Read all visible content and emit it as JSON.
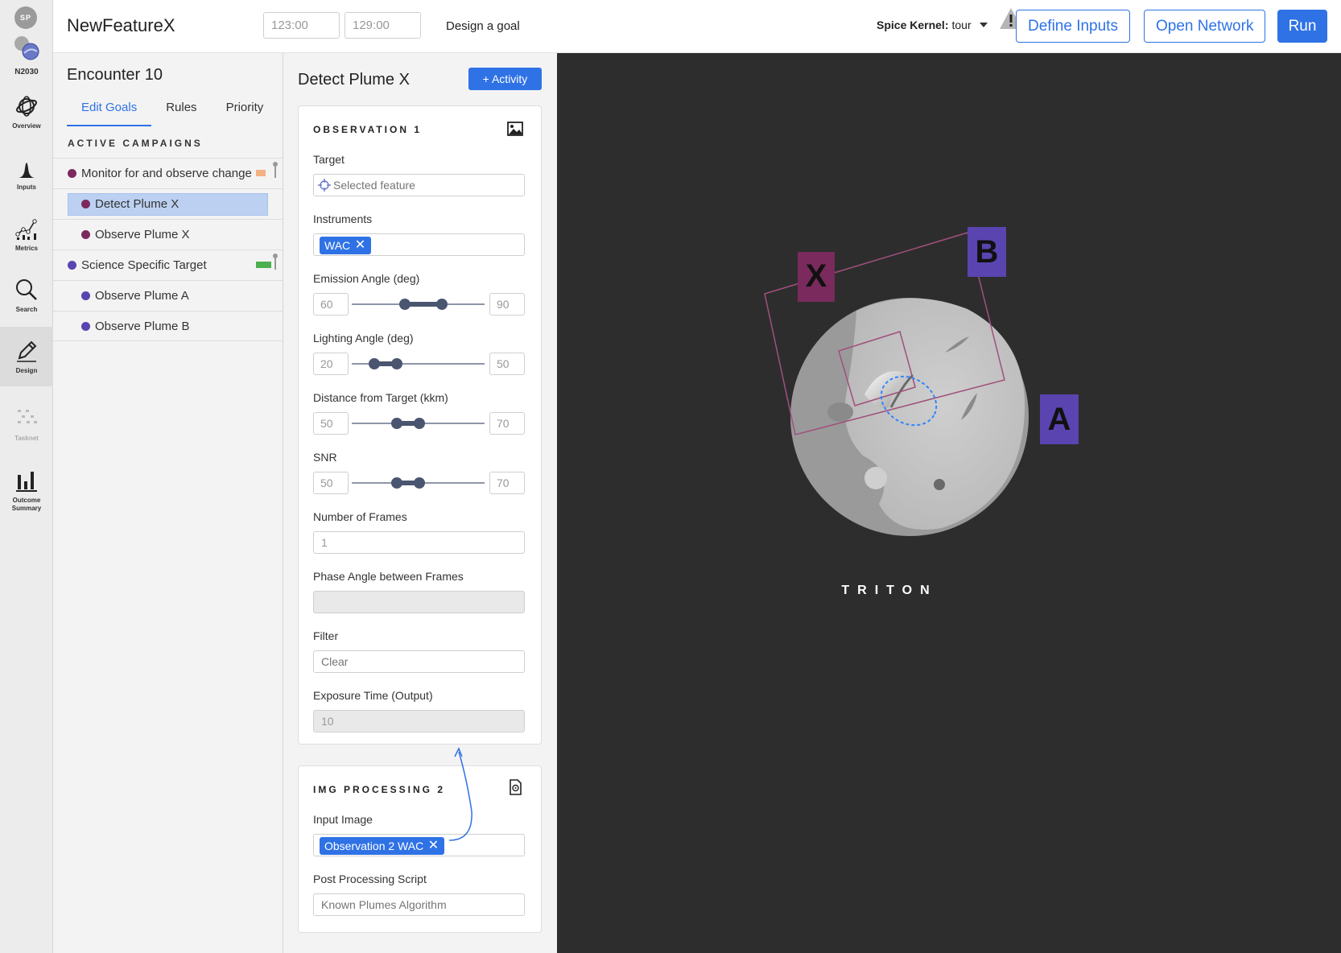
{
  "user": {
    "initials": "SP"
  },
  "brand": {
    "logo_label": "N2030"
  },
  "nav": [
    {
      "label": "Overview",
      "icon": "globe-icon",
      "active": false
    },
    {
      "label": "Inputs",
      "icon": "distribution-icon",
      "active": false
    },
    {
      "label": "Metrics",
      "icon": "metrics-chart-icon",
      "active": false
    },
    {
      "label": "Search",
      "icon": "search-icon",
      "active": false
    },
    {
      "label": "Design",
      "icon": "pencil-icon",
      "active": true
    },
    {
      "label": "Tasknet",
      "icon": "tasknet-icon",
      "active": false
    },
    {
      "label": "Outcome Summary",
      "icon": "bar-chart-icon",
      "active": false
    }
  ],
  "header": {
    "title": "NewFeatureX",
    "time_start": "123:00",
    "time_end": "129:00",
    "goal_text": "Design a goal",
    "kernel_label": "Spice Kernel:",
    "kernel_value": "tour",
    "define_inputs": "Define Inputs",
    "open_network": "Open Network",
    "run": "Run"
  },
  "goals": {
    "encounter": "Encounter 10",
    "tabs": [
      "Edit Goals",
      "Rules",
      "Priority"
    ],
    "active_tab": "Edit Goals",
    "section_title": "ACTIVE CAMPAIGNS",
    "campaigns": [
      {
        "label": "Monitor for and observe change",
        "color": "#7a2a5c",
        "level": "top",
        "progress": 0.55,
        "progress_color": "#f4b183"
      },
      {
        "label": "Detect Plume X",
        "color": "#7a2a5c",
        "level": "sub",
        "selected": true
      },
      {
        "label": "Observe Plume X",
        "color": "#7a2a5c",
        "level": "sub"
      },
      {
        "label": "Science Specific Target",
        "color": "#5a44b0",
        "level": "top",
        "progress": 0.85,
        "progress_color": "#4caf50"
      },
      {
        "label": "Observe Plume A",
        "color": "#5a44b0",
        "level": "sub"
      },
      {
        "label": "Observe Plume B",
        "color": "#5a44b0",
        "level": "sub"
      }
    ]
  },
  "detail": {
    "title": "Detect Plume X",
    "add_activity": "+ Activity",
    "observation": {
      "header": "OBSERVATION 1",
      "target_label": "Target",
      "target_placeholder": "Selected feature",
      "instruments_label": "Instruments",
      "instrument_tag": "WAC",
      "tag_remove": "✕",
      "sliders": [
        {
          "label": "Emission Angle (deg)",
          "min": "60",
          "max": "90",
          "lo": 0.4,
          "hi": 0.68
        },
        {
          "label": "Lighting Angle (deg)",
          "min": "20",
          "max": "50",
          "lo": 0.17,
          "hi": 0.34
        },
        {
          "label": "Distance from Target (kkm)",
          "min": "50",
          "max": "70",
          "lo": 0.34,
          "hi": 0.51
        },
        {
          "label": "SNR",
          "min": "50",
          "max": "70",
          "lo": 0.34,
          "hi": 0.51
        }
      ],
      "frames_label": "Number of Frames",
      "frames_value": "1",
      "phase_label": "Phase Angle between Frames",
      "phase_value": "",
      "filter_label": "Filter",
      "filter_placeholder": "Clear",
      "exposure_label": "Exposure Time (Output)",
      "exposure_value": "10"
    },
    "processing": {
      "header": "IMG PROCESSING 2",
      "input_label": "Input Image",
      "input_tag": "Observation 2 WAC",
      "tag_remove": "✕",
      "script_label": "Post Processing Script",
      "script_placeholder": "Known Plumes Algorithm"
    }
  },
  "viewer": {
    "body_name": "TRITON",
    "markers": [
      {
        "label": "X",
        "color": "#7a2a5c"
      },
      {
        "label": "B",
        "color": "#5a44b0"
      },
      {
        "label": "A",
        "color": "#5a44b0"
      }
    ]
  }
}
